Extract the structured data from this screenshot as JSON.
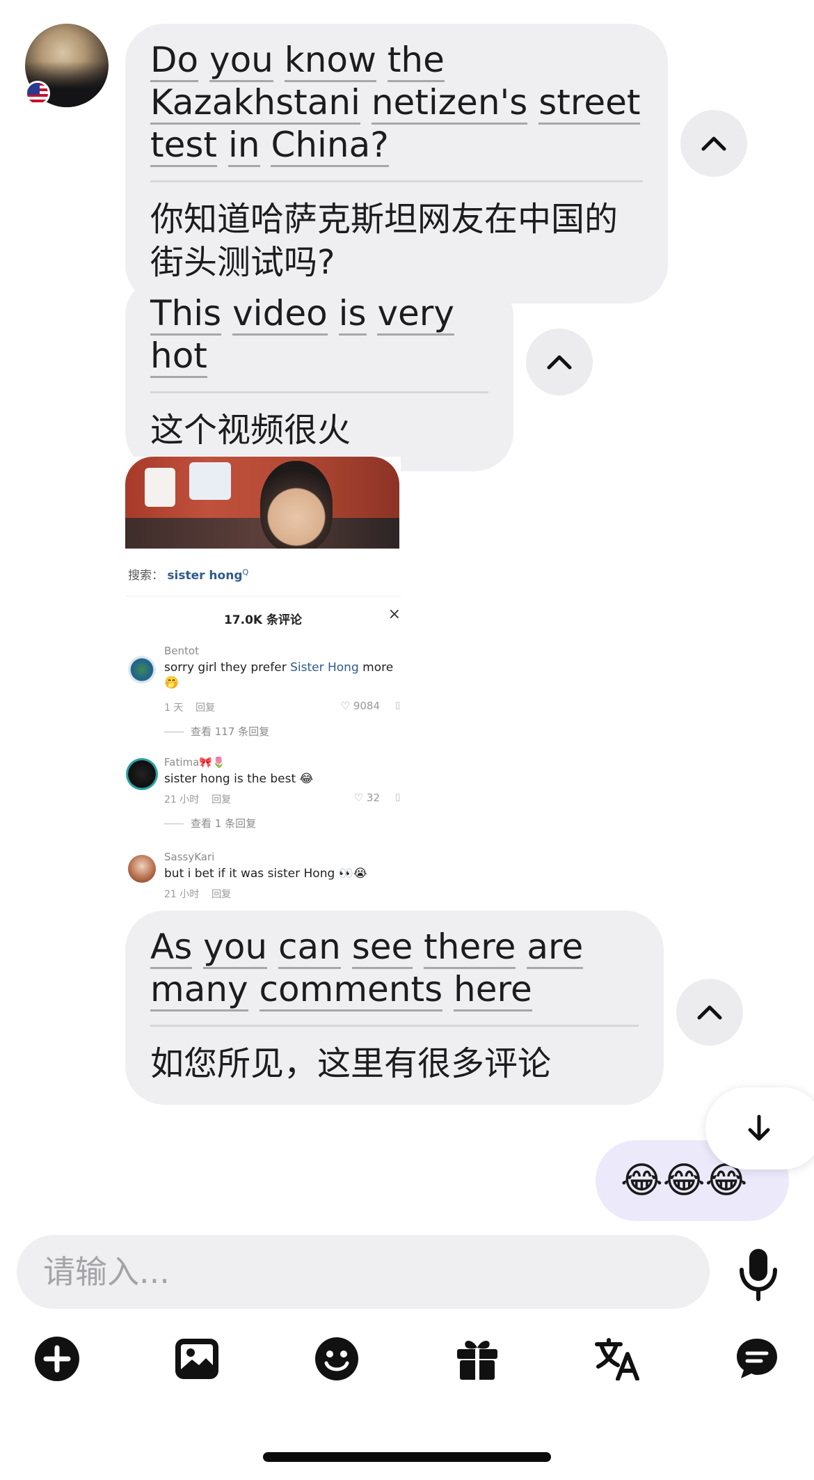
{
  "messages": [
    {
      "id": "m1",
      "en_words": [
        "Do",
        "you",
        "know",
        "the",
        "Kazakhstani",
        "netizen's",
        "street",
        "test",
        "in",
        "China?"
      ],
      "zh": "你知道哈萨克斯坦网友在中国的街头测试吗?"
    },
    {
      "id": "m2",
      "en_words": [
        "This",
        "video",
        "is",
        "very",
        "hot"
      ],
      "zh": "这个视频很火"
    },
    {
      "id": "m4",
      "en_words": [
        "As",
        "you",
        "can",
        "see",
        "there",
        "are",
        "many",
        "comments",
        "here"
      ],
      "zh": "如您所见，这里有很多评论"
    }
  ],
  "screenshot": {
    "search_prefix": "搜索：",
    "search_term": "sister hong",
    "comment_count": "17.0K 条评论",
    "close": "×",
    "comments": [
      {
        "user": "Bentot",
        "text_before": "sorry girl they prefer ",
        "text_highlight": "Sister Hong",
        "text_after": " more 🤭",
        "time": "1 天",
        "reply": "回复",
        "likes": "♡ 9084",
        "view_replies": "查看 117 条回复"
      },
      {
        "user": "Fatima🎀🌷",
        "text": "sister hong is the best 😂",
        "time": "21 小时",
        "reply": "回复",
        "likes": "♡ 32",
        "view_replies": "查看 1 条回复"
      },
      {
        "user": "SassyKari",
        "text": "but i bet if it was sister Hong 👀😭",
        "time": "21 小时",
        "reply": "回复"
      }
    ]
  },
  "my_message": {
    "text": "😂😂😂"
  },
  "composer": {
    "placeholder": "请输入..."
  },
  "toolbar": {
    "icons": [
      "add-icon",
      "image-icon",
      "emoji-icon",
      "gift-icon",
      "translate-icon",
      "chat-icon"
    ]
  },
  "colors": {
    "bubble_gray": "#efeff1",
    "my_bubble": "#ece9fb",
    "link_blue": "#2e5a8e"
  }
}
